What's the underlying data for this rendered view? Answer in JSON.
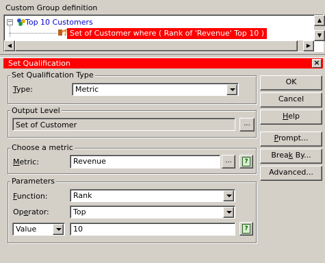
{
  "custom_group": {
    "title": "Custom Group definition",
    "tree": {
      "root_label": "Top 10 Customers",
      "child_label": "Set of Customer  where ( Rank of 'Revenue' Top 10 )"
    }
  },
  "dialog": {
    "title": "Set Qualification",
    "qualification_type": {
      "legend": "Set Qualification Type",
      "type_label_underlined": "T",
      "type_label_rest": "ype:",
      "type_value": "Metric"
    },
    "output_level": {
      "legend": "Output Level",
      "value": "Set of Customer",
      "browse_label": "..."
    },
    "metric": {
      "legend": "Choose a metric",
      "label_underlined": "M",
      "label_rest": "etric:",
      "value": "Revenue",
      "browse_label": "..."
    },
    "parameters": {
      "legend": "Parameters",
      "function_label_underlined": "F",
      "function_label_rest": "unction:",
      "function_value": "Rank",
      "operator_label_prefix": "Op",
      "operator_label_underlined": "e",
      "operator_label_rest": "rator:",
      "operator_value": "Top",
      "value_type": "Value",
      "value": "10"
    },
    "buttons": {
      "ok": "OK",
      "cancel": "Cancel",
      "help_underlined": "H",
      "help_rest": "elp",
      "prompt_underlined": "P",
      "prompt_rest": "rompt...",
      "break_by_prefix": "Brea",
      "break_by_underlined": "k",
      "break_by_rest": " By...",
      "advanced": "Advanced..."
    }
  }
}
